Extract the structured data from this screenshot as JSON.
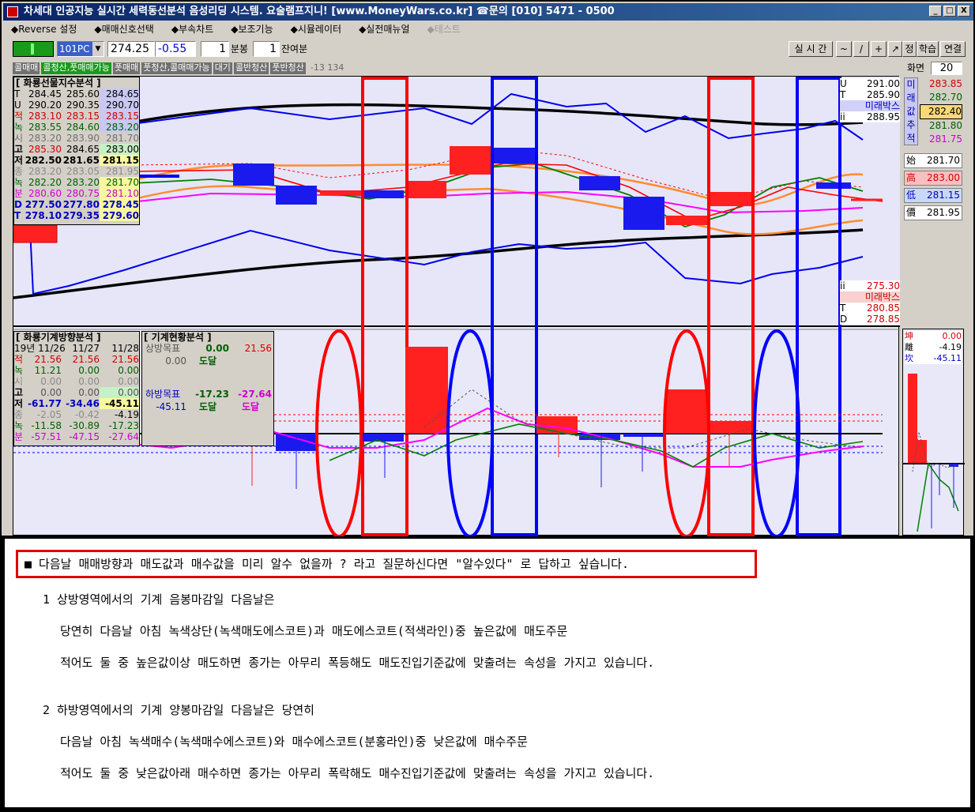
{
  "window": {
    "title": "차세대 인공지능 실시간 세력동선분석 음성리딩 시스템. 요술램프지니! [www.MoneyWars.co.kr] ☎문의 [010] 5471 - 0500",
    "btn_min": "_",
    "btn_max": "□",
    "btn_close": "X"
  },
  "menu": [
    {
      "label": "◆Reverse 설정"
    },
    {
      "label": "◆매매신호선택"
    },
    {
      "label": "◆부속차트"
    },
    {
      "label": "◆보조기능"
    },
    {
      "label": "◆시뮬레이터"
    },
    {
      "label": "◆실전매뉴얼"
    },
    {
      "label": "◆테스트"
    }
  ],
  "toolbar": {
    "symbol": "101PC",
    "price": "274.25",
    "change": "-0.55",
    "interval_value": "1",
    "interval_unit": "분봉",
    "remain_value": "1",
    "remain_unit": "잔여분",
    "realtime": "실 시 간",
    "tools": [
      "~",
      "/",
      "+",
      "↗",
      "정",
      "학습",
      "연결"
    ],
    "screen_label": "화면",
    "screen_value": "20"
  },
  "tabs": [
    "콜매매",
    "콜청산,풋매매가능",
    "풋매매",
    "풋청산,콜매매가능",
    "대기",
    "콜반청산",
    "풋반청산",
    "-13 134"
  ],
  "box1": {
    "title": "[ 화룡선물지수분석 ]",
    "rows": [
      {
        "k": "T",
        "a": "284.45",
        "b": "285.60",
        "c": "284.65"
      },
      {
        "k": "U",
        "a": "290.20",
        "b": "290.35",
        "c": "290.70"
      },
      {
        "k": "적",
        "a": "283.10",
        "b": "283.15",
        "c": "283.15"
      },
      {
        "k": "녹",
        "a": "283.55",
        "b": "284.60",
        "c": "283.20"
      },
      {
        "k": "시",
        "a": "283.20",
        "b": "283.90",
        "c": "281.70"
      },
      {
        "k": "고",
        "a": "285.30",
        "b": "284.65",
        "c": "283.00"
      },
      {
        "k": "저",
        "a": "282.50",
        "b": "281.65",
        "c": "281.15"
      },
      {
        "k": "종",
        "a": "283.20",
        "b": "283.05",
        "c": "281.95"
      },
      {
        "k": "녹",
        "a": "282.20",
        "b": "283.20",
        "c": "281.70"
      },
      {
        "k": "분",
        "a": "280.60",
        "b": "280.75",
        "c": "281.10"
      },
      {
        "k": "D",
        "a": "277.50",
        "b": "277.80",
        "c": "278.45"
      },
      {
        "k": "T",
        "a": "278.10",
        "b": "279.35",
        "c": "279.60"
      }
    ]
  },
  "box2": {
    "title": "[ 화룡기계방향분석 ]",
    "dates": [
      "19년 11/26",
      "11/27",
      "11/28"
    ],
    "rows": [
      {
        "k": "적",
        "a": "21.56",
        "b": "21.56",
        "c": "21.56"
      },
      {
        "k": "녹",
        "a": "11.21",
        "b": "0.00",
        "c": "0.00"
      },
      {
        "k": "시",
        "a": "0.00",
        "b": "0.00",
        "c": "0.00"
      },
      {
        "k": "고",
        "a": "0.00",
        "b": "0.00",
        "c": "0.00"
      },
      {
        "k": "저",
        "a": "-61.77",
        "b": "-34.46",
        "c": "-45.11"
      },
      {
        "k": "종",
        "a": "-2.05",
        "b": "-0.42",
        "c": "-4.19"
      },
      {
        "k": "녹",
        "a": "-11.58",
        "b": "-30.89",
        "c": "-17.23"
      },
      {
        "k": "분",
        "a": "-57.51",
        "b": "-47.15",
        "c": "-27.64"
      }
    ]
  },
  "box3": {
    "title": "[ 기계현황분석 ]",
    "up_label": "상방목표",
    "up_a": "0.00",
    "up_b": "21.56",
    "up_c": "0.00",
    "up_d": "도달",
    "down_label": "하방목표",
    "down_a": "-17.23",
    "down_b": "-27.64",
    "down_c": "-45.11",
    "down_d": "도달",
    "down_e": "도달"
  },
  "right_top": [
    {
      "k": "U",
      "v": "291.00"
    },
    {
      "k": "T",
      "v": "285.90"
    },
    {
      "k": "",
      "v": "미래박스"
    },
    {
      "k": "ii",
      "v": "288.95"
    }
  ],
  "right_bottom": [
    {
      "k": "ii",
      "v": "275.30"
    },
    {
      "k": "",
      "v": "미래박스"
    },
    {
      "k": "T",
      "v": "280.85"
    },
    {
      "k": "D",
      "v": "278.85"
    }
  ],
  "side_vertical": [
    "미",
    "래",
    "값",
    "추",
    "적"
  ],
  "side_values": [
    "283.85",
    "282.70",
    "282.40",
    "281.80",
    "281.75"
  ],
  "ohlc": [
    {
      "k": "始",
      "v": "281.70"
    },
    {
      "k": "高",
      "v": "283.00"
    },
    {
      "k": "低",
      "v": "281.15"
    },
    {
      "k": "價",
      "v": "281.95"
    }
  ],
  "sub_side": [
    {
      "k": "坤",
      "v": "0.00"
    },
    {
      "k": "離",
      "v": "-4.19"
    },
    {
      "k": "坎",
      "v": "-45.11"
    }
  ],
  "note": {
    "headline": "■ 다음날 매매방향과 매도값과 매수값을 미리 알수 없을까 ?  라고 질문하신다면 \"알수있다\" 로 답하고 싶습니다.",
    "l1": "1 상방영역에서의 기계 음봉마감일 다음날은",
    "l2": "당연히 다음날 아침 녹색상단(녹색매도에스코트)과 매도에스코트(적색라인)중 높은값에 매도주문",
    "l3": "적어도 둘 중 높은값이상 매도하면 종가는 아무리 폭등해도 매도진입기준값에 맞출려는 속성을 가지고 있습니다.",
    "l4": "2 하방영역에서의 기계 양봉마감일 다음날은 당연히",
    "l5": "다음날 아침 녹색매수(녹색매수에스코트)와 매수에스코트(분홍라인)중 낮은값에 매수주문",
    "l6": "적어도 둘 중 낮은값아래 매수하면 종가는 아무리 폭락해도 매수진입기준값에 맞출려는 속성을 가지고 있습니다."
  },
  "colors": {
    "red": "#ff0000",
    "blue": "#0000ff",
    "green": "#008000",
    "orange": "#ff8c30",
    "pink": "#ff00ff",
    "black": "#000000"
  }
}
